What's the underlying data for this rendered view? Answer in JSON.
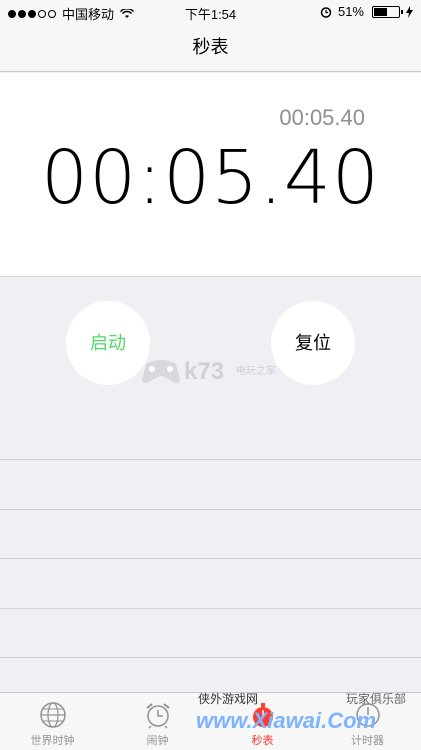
{
  "status": {
    "carrier": "中国移动",
    "time": "下午1:54",
    "battery": "51%"
  },
  "nav": {
    "title": "秒表"
  },
  "timer": {
    "lap_time": "00:05.40",
    "main_time": "00:05.40"
  },
  "controls": {
    "start": "启动",
    "reset": "复位"
  },
  "watermark": {
    "k73": "k73",
    "k73_sub": "电玩之家",
    "xiawai_top": "侠外游戏网",
    "xiawai": "www.Xiawai.Com",
    "xiawai_right": "玩家俱乐部"
  },
  "tabs": [
    {
      "label": "世界时钟",
      "icon": "globe-icon"
    },
    {
      "label": "闹钟",
      "icon": "alarm-clock-icon"
    },
    {
      "label": "秒表",
      "icon": "stopwatch-icon"
    },
    {
      "label": "计时器",
      "icon": "timer-icon"
    }
  ],
  "colors": {
    "start": "#4cd964",
    "active_tab": "#ff3b30"
  }
}
